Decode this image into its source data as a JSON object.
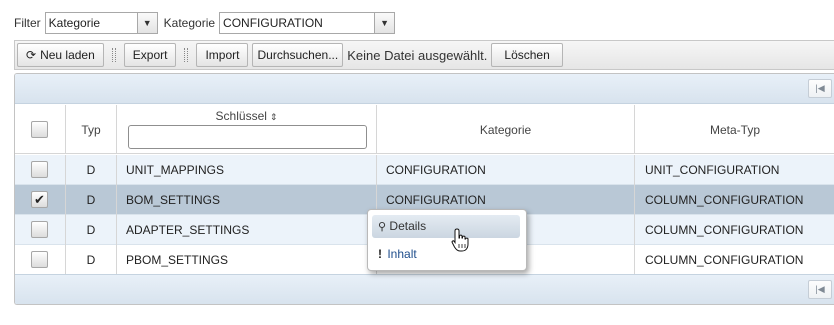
{
  "filter": {
    "filter_label": "Filter",
    "filter_value": "Kategorie",
    "kategorie_label": "Kategorie",
    "kategorie_value": "CONFIGURATION"
  },
  "toolbar": {
    "reload_label": "Neu laden",
    "export_label": "Export",
    "import_label": "Import",
    "browse_label": "Durchsuchen...",
    "no_file_text": "Keine Datei ausgewählt.",
    "delete_label": "Löschen"
  },
  "table": {
    "columns": {
      "typ": "Typ",
      "schluessel": "Schlüssel",
      "kategorie": "Kategorie",
      "meta_typ": "Meta-Typ"
    },
    "rows": [
      {
        "checked": false,
        "typ": "D",
        "key": "UNIT_MAPPINGS",
        "kategorie": "CONFIGURATION",
        "meta_typ": "UNIT_CONFIGURATION"
      },
      {
        "checked": true,
        "typ": "D",
        "key": "BOM_SETTINGS",
        "kategorie": "CONFIGURATION",
        "meta_typ": "COLUMN_CONFIGURATION"
      },
      {
        "checked": false,
        "typ": "D",
        "key": "ADAPTER_SETTINGS",
        "kategorie": "CONFIGURATION",
        "meta_typ": "COLUMN_CONFIGURATION"
      },
      {
        "checked": false,
        "typ": "D",
        "key": "PBOM_SETTINGS",
        "kategorie": "CONFIGURATION",
        "meta_typ": "COLUMN_CONFIGURATION"
      }
    ]
  },
  "context_menu": {
    "details_label": "Details",
    "inhalt_label": "Inhalt"
  },
  "icons": {
    "reload": "refresh-icon",
    "details": "search-icon",
    "inhalt": "exclamation-icon",
    "first_page": "first-page-icon",
    "sort": "sort-icon",
    "dropdown": "chevron-down-icon",
    "cursor": "hand-cursor-icon"
  },
  "colors": {
    "selected_row": "#b9c8d6",
    "odd_row": "#ecf3fa",
    "grid_bar": "#d8e3ee",
    "menu_link": "#1f4e8c"
  }
}
